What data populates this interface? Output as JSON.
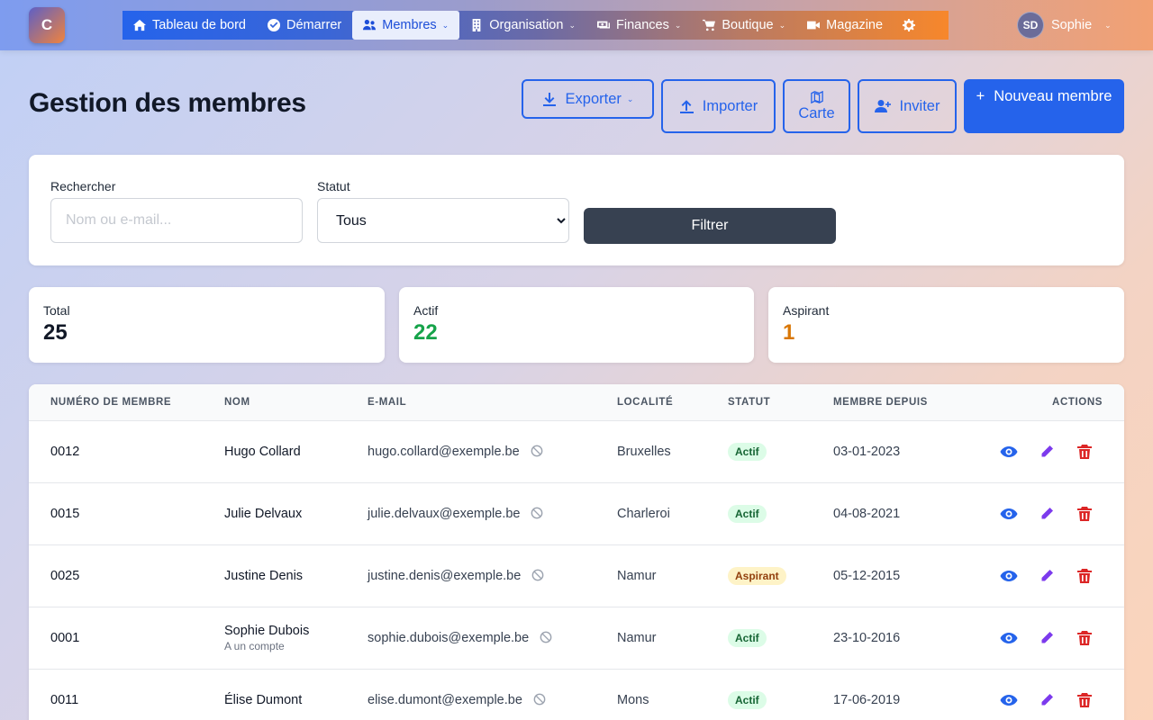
{
  "app": {
    "logo_letter": "C"
  },
  "nav": [
    {
      "label": "Tableau de bord",
      "icon": "home-icon",
      "dropdown": false,
      "active": false
    },
    {
      "label": "Démarrer",
      "icon": "check-circle-icon",
      "dropdown": false,
      "active": false
    },
    {
      "label": "Membres",
      "icon": "users-icon",
      "dropdown": true,
      "active": true
    },
    {
      "label": "Organisation",
      "icon": "building-icon",
      "dropdown": true,
      "active": false
    },
    {
      "label": "Finances",
      "icon": "money-icon",
      "dropdown": true,
      "active": false
    },
    {
      "label": "Boutique",
      "icon": "cart-icon",
      "dropdown": true,
      "active": false
    },
    {
      "label": "Magazine",
      "icon": "video-icon",
      "dropdown": false,
      "active": false
    }
  ],
  "user": {
    "initials": "SD",
    "name": "Sophie"
  },
  "page": {
    "title": "Gestion des membres"
  },
  "toolbar": {
    "export_label": "Exporter",
    "import_label": "Importer",
    "map_label": "Carte",
    "invite_label": "Inviter",
    "new_label": "Nouveau membre",
    "new_prefix": "+"
  },
  "filters": {
    "search_label": "Rechercher",
    "search_placeholder": "Nom ou e-mail...",
    "status_label": "Statut",
    "status_value": "Tous",
    "filter_button": "Filtrer"
  },
  "stats": [
    {
      "label": "Total",
      "value": "25",
      "color": "#111827"
    },
    {
      "label": "Actif",
      "value": "22",
      "color": "#16a34a"
    },
    {
      "label": "Aspirant",
      "value": "1",
      "color": "#d97706"
    }
  ],
  "table": {
    "headers": [
      "NUMÉRO DE MEMBRE",
      "NOM",
      "E-MAIL",
      "LOCALITÉ",
      "STATUT",
      "MEMBRE DEPUIS",
      "ACTIONS"
    ],
    "rows": [
      {
        "num": "0012",
        "name": "Hugo Collard",
        "sub": "",
        "email": "hugo.collard@exemple.be",
        "city": "Bruxelles",
        "status": "Actif",
        "since": "03-01-2023"
      },
      {
        "num": "0015",
        "name": "Julie Delvaux",
        "sub": "",
        "email": "julie.delvaux@exemple.be",
        "city": "Charleroi",
        "status": "Actif",
        "since": "04-08-2021"
      },
      {
        "num": "0025",
        "name": "Justine Denis",
        "sub": "",
        "email": "justine.denis@exemple.be",
        "city": "Namur",
        "status": "Aspirant",
        "since": "05-12-2015"
      },
      {
        "num": "0001",
        "name": "Sophie Dubois",
        "sub": "A un compte",
        "email": "sophie.dubois@exemple.be",
        "city": "Namur",
        "status": "Actif",
        "since": "23-10-2016"
      },
      {
        "num": "0011",
        "name": "Élise Dumont",
        "sub": "",
        "email": "elise.dumont@exemple.be",
        "city": "Mons",
        "status": "Actif",
        "since": "17-06-2019"
      }
    ]
  },
  "colors": {
    "accent": "#2563eb",
    "danger": "#dc2626",
    "edit": "#7c3aed",
    "dark_button": "#374151"
  }
}
